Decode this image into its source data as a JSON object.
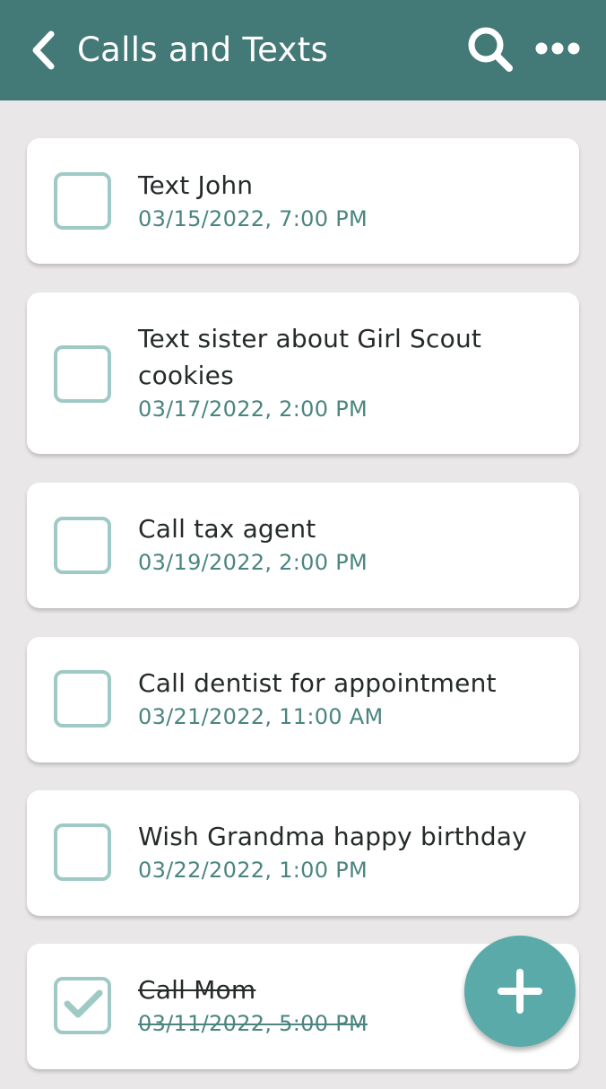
{
  "header": {
    "title": "Calls and Texts",
    "back_icon": "chevron-left-icon",
    "search_icon": "search-icon",
    "more_icon": "more-horizontal-icon"
  },
  "tasks": [
    {
      "title": "Text John",
      "date": "03/15/2022, 7:00 PM",
      "completed": false
    },
    {
      "title": "Text sister about Girl Scout cookies",
      "date": "03/17/2022, 2:00 PM",
      "completed": false
    },
    {
      "title": "Call tax agent",
      "date": "03/19/2022, 2:00 PM",
      "completed": false
    },
    {
      "title": "Call dentist for appointment",
      "date": "03/21/2022, 11:00 AM",
      "completed": false
    },
    {
      "title": "Wish Grandma happy birthday",
      "date": "03/22/2022, 1:00 PM",
      "completed": false
    },
    {
      "title": "Call Mom",
      "date": "03/11/2022, 5:00 PM",
      "completed": true
    }
  ],
  "fab": {
    "icon": "plus-icon"
  },
  "colors": {
    "header_bg": "#437a78",
    "page_bg": "#e9e7e7",
    "checkbox_border": "#9fc9c5",
    "date_text": "#4a8580",
    "fab_bg": "#5aaaa9"
  }
}
